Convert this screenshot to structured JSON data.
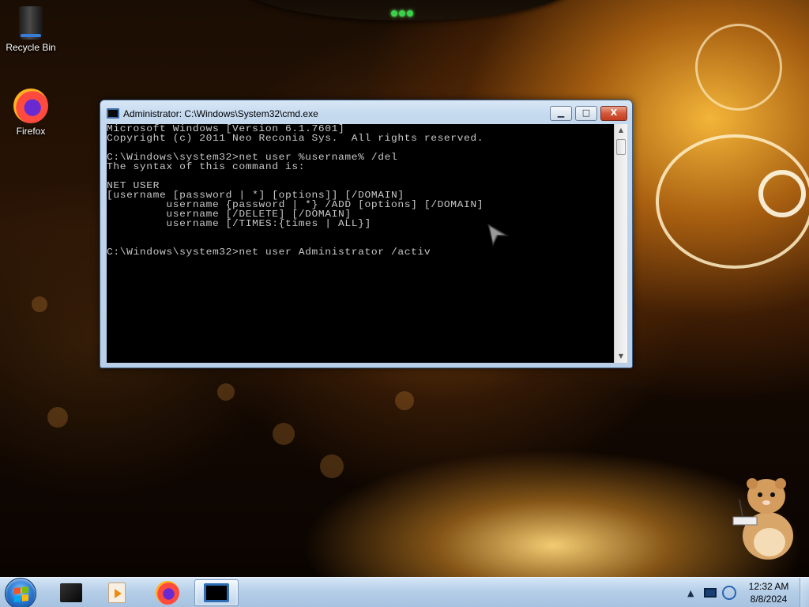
{
  "desktop": {
    "icons": [
      {
        "label": "Recycle Bin",
        "icon": "recycle-bin-icon"
      },
      {
        "label": "Firefox",
        "icon": "firefox-icon"
      }
    ]
  },
  "cmd_window": {
    "title": "Administrator: C:\\Windows\\System32\\cmd.exe",
    "buttons": {
      "minimize": "▁",
      "maximize": "□",
      "close": "X"
    },
    "console_lines": [
      "Microsoft Windows [Version 6.1.7601]",
      "Copyright (c) 2011 Neo Reconia Sys.  All rights reserved.",
      "",
      "C:\\Windows\\system32>net user %username% /del",
      "The syntax of this command is:",
      "",
      "NET USER",
      "[username [password | *] [options]] [/DOMAIN]",
      "         username {password | *} /ADD [options] [/DOMAIN]",
      "         username [/DELETE] [/DOMAIN]",
      "         username [/TIMES:{times | ALL}]",
      "",
      "",
      "C:\\Windows\\system32>net user Administrator /activ"
    ]
  },
  "taskbar": {
    "pinned": [
      {
        "name": "dark-app-icon",
        "active": false
      },
      {
        "name": "media-player-icon",
        "active": false
      },
      {
        "name": "firefox-icon",
        "active": false
      },
      {
        "name": "cmd-icon",
        "active": true
      }
    ],
    "tray": {
      "show_hidden": "▲"
    },
    "clock": {
      "time": "12:32 AM",
      "date": "8/8/2024"
    }
  },
  "colors": {
    "console_bg": "#000000",
    "console_text": "#c8c8c8",
    "taskbar": "#b6cfe8",
    "close_button": "#d4583a"
  }
}
